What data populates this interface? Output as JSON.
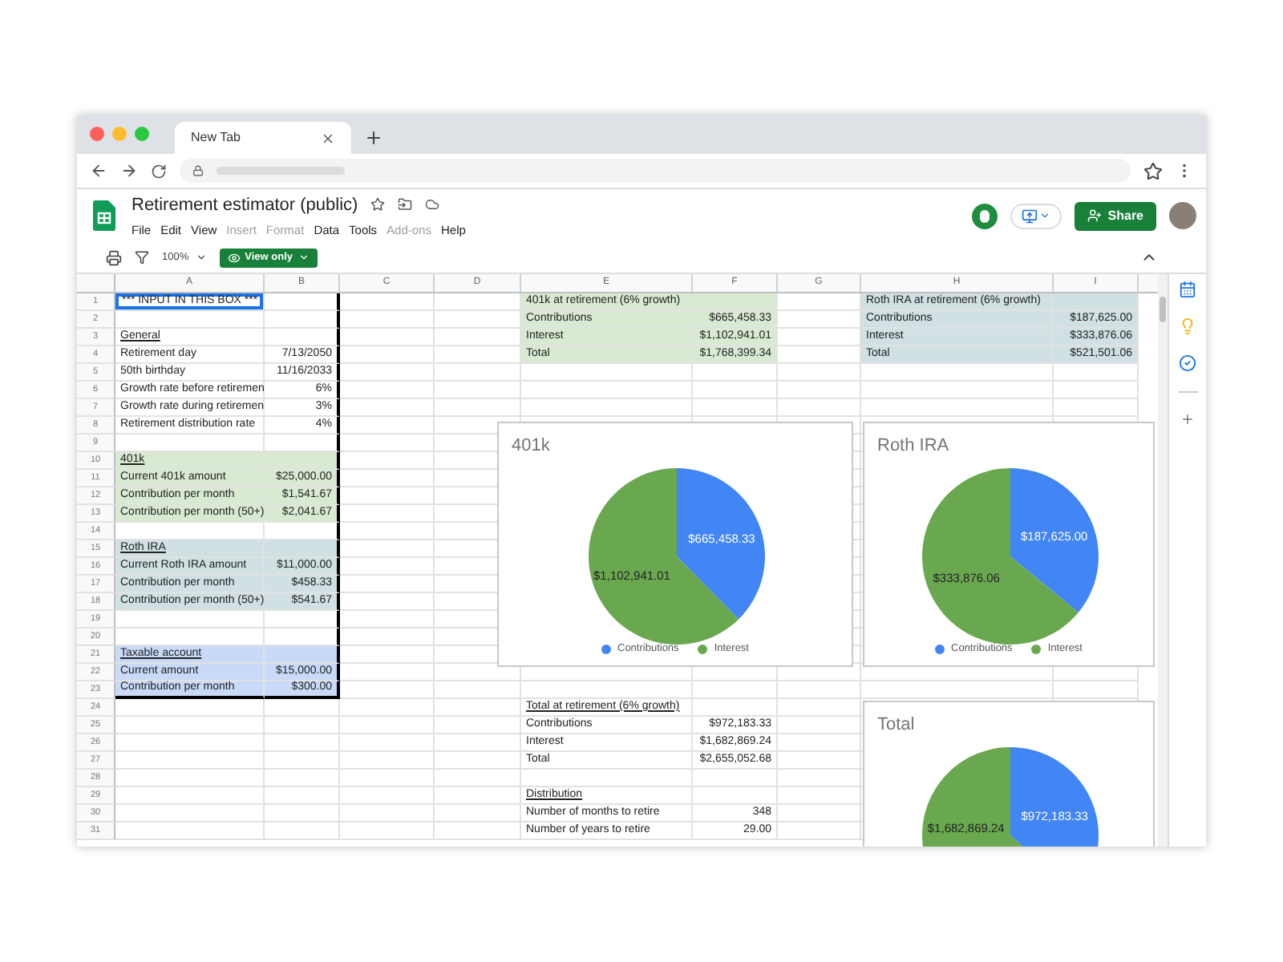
{
  "browser": {
    "tab": {
      "title": "New Tab"
    }
  },
  "document": {
    "title": "Retirement estimator (public)",
    "share_button": "Share",
    "menu": [
      {
        "label": "File",
        "disabled": false
      },
      {
        "label": "Edit",
        "disabled": false
      },
      {
        "label": "View",
        "disabled": false
      },
      {
        "label": "Insert",
        "disabled": true
      },
      {
        "label": "Format",
        "disabled": true
      },
      {
        "label": "Data",
        "disabled": false
      },
      {
        "label": "Tools",
        "disabled": false
      },
      {
        "label": "Add-ons",
        "disabled": true
      },
      {
        "label": "Help",
        "disabled": false
      }
    ]
  },
  "toolbar": {
    "zoom": "100%",
    "mode_button": "View only"
  },
  "sheet": {
    "columns": [
      "A",
      "B",
      "C",
      "D",
      "E",
      "F",
      "G",
      "H",
      "I"
    ],
    "rows": [
      {
        "number": "1",
        "boxed": true,
        "cells": {
          "A": {
            "kind": "active",
            "text": "*** INPUT IN THIS BOX ***"
          },
          "E": {
            "kind": "label",
            "text": "401k at retirement (6% growth)",
            "color": "#d9ead3"
          },
          "F": {
            "color": "#d9ead3"
          },
          "H": {
            "kind": "label",
            "text": "Roth IRA at retirement (6% growth)",
            "color": "#d0e0e3"
          },
          "I": {
            "color": "#d0e0e3"
          }
        }
      },
      {
        "number": "2",
        "boxed": true,
        "cells": {
          "E": {
            "kind": "label",
            "text": "Contributions",
            "color": "#d9ead3"
          },
          "F": {
            "kind": "number",
            "text": "$665,458.33",
            "color": "#d9ead3"
          },
          "H": {
            "kind": "label",
            "text": "Contributions",
            "color": "#d0e0e3"
          },
          "I": {
            "kind": "number",
            "text": "$187,625.00",
            "color": "#d0e0e3"
          }
        }
      },
      {
        "number": "3",
        "boxed": true,
        "cells": {
          "A": {
            "kind": "heading",
            "text": "General"
          },
          "E": {
            "kind": "label",
            "text": "Interest",
            "color": "#d9ead3"
          },
          "F": {
            "kind": "number",
            "text": "$1,102,941.01",
            "color": "#d9ead3"
          },
          "H": {
            "kind": "label",
            "text": "Interest",
            "color": "#d0e0e3"
          },
          "I": {
            "kind": "number",
            "text": "$333,876.06",
            "color": "#d0e0e3"
          }
        }
      },
      {
        "number": "4",
        "boxed": true,
        "cells": {
          "A": {
            "kind": "label",
            "text": "Retirement day"
          },
          "B": {
            "kind": "number",
            "text": "7/13/2050"
          },
          "E": {
            "kind": "label",
            "text": "Total",
            "color": "#d9ead3"
          },
          "F": {
            "kind": "number",
            "text": "$1,768,399.34",
            "color": "#d9ead3"
          },
          "H": {
            "kind": "label",
            "text": "Total",
            "color": "#d0e0e3"
          },
          "I": {
            "kind": "number",
            "text": "$521,501.06",
            "color": "#d0e0e3"
          }
        }
      },
      {
        "number": "5",
        "boxed": true,
        "cells": {
          "A": {
            "kind": "label",
            "text": "50th birthday"
          },
          "B": {
            "kind": "number",
            "text": "11/16/2033"
          }
        }
      },
      {
        "number": "6",
        "boxed": true,
        "cells": {
          "A": {
            "kind": "label",
            "text": "Growth rate before retiremen"
          },
          "B": {
            "kind": "number",
            "text": "6%"
          }
        }
      },
      {
        "number": "7",
        "boxed": true,
        "cells": {
          "A": {
            "kind": "label",
            "text": "Growth rate during retiremen"
          },
          "B": {
            "kind": "number",
            "text": "3%"
          }
        }
      },
      {
        "number": "8",
        "boxed": true,
        "cells": {
          "A": {
            "kind": "label",
            "text": "Retirement distribution rate"
          },
          "B": {
            "kind": "number",
            "text": "4%"
          }
        }
      },
      {
        "number": "9",
        "boxed": true,
        "cells": {}
      },
      {
        "number": "10",
        "boxed": true,
        "cells": {
          "A": {
            "kind": "heading",
            "text": "401k",
            "color": "#d9ead3"
          },
          "B": {
            "color": "#d9ead3"
          }
        }
      },
      {
        "number": "11",
        "boxed": true,
        "cells": {
          "A": {
            "kind": "label",
            "text": "Current 401k amount",
            "color": "#d9ead3"
          },
          "B": {
            "kind": "number",
            "text": "$25,000.00",
            "color": "#d9ead3"
          }
        }
      },
      {
        "number": "12",
        "boxed": true,
        "cells": {
          "A": {
            "kind": "label",
            "text": "Contribution per month",
            "color": "#d9ead3"
          },
          "B": {
            "kind": "number",
            "text": "$1,541.67",
            "color": "#d9ead3"
          }
        }
      },
      {
        "number": "13",
        "boxed": true,
        "cells": {
          "A": {
            "kind": "label",
            "text": "Contribution per month (50+)",
            "color": "#d9ead3"
          },
          "B": {
            "kind": "number",
            "text": "$2,041.67",
            "color": "#d9ead3"
          }
        }
      },
      {
        "number": "14",
        "boxed": true,
        "cells": {}
      },
      {
        "number": "15",
        "boxed": true,
        "cells": {
          "A": {
            "kind": "heading",
            "text": "Roth IRA",
            "color": "#d0e0e3"
          },
          "B": {
            "color": "#d0e0e3"
          }
        }
      },
      {
        "number": "16",
        "boxed": true,
        "cells": {
          "A": {
            "kind": "label",
            "text": "Current Roth IRA amount",
            "color": "#d0e0e3"
          },
          "B": {
            "kind": "number",
            "text": "$11,000.00",
            "color": "#d0e0e3"
          }
        }
      },
      {
        "number": "17",
        "boxed": true,
        "cells": {
          "A": {
            "kind": "label",
            "text": "Contribution per month",
            "color": "#d0e0e3"
          },
          "B": {
            "kind": "number",
            "text": "$458.33",
            "color": "#d0e0e3"
          }
        }
      },
      {
        "number": "18",
        "boxed": true,
        "cells": {
          "A": {
            "kind": "label",
            "text": "Contribution per month (50+)",
            "color": "#d0e0e3"
          },
          "B": {
            "kind": "number",
            "text": "$541.67",
            "color": "#d0e0e3"
          }
        }
      },
      {
        "number": "19",
        "boxed": true,
        "cells": {}
      },
      {
        "number": "20",
        "boxed": true,
        "cells": {}
      },
      {
        "number": "21",
        "boxed": true,
        "cells": {
          "A": {
            "kind": "heading",
            "text": "Taxable account",
            "color": "#c9daf8"
          },
          "B": {
            "color": "#c9daf8"
          }
        }
      },
      {
        "number": "22",
        "boxed": true,
        "cells": {
          "A": {
            "kind": "label",
            "text": "Current amount",
            "color": "#c9daf8"
          },
          "B": {
            "kind": "number",
            "text": "$15,000.00",
            "color": "#c9daf8"
          }
        }
      },
      {
        "number": "23",
        "boxed": true,
        "cells": {
          "A": {
            "kind": "label",
            "text": "Contribution per month",
            "color": "#c9daf8"
          },
          "B": {
            "kind": "number",
            "text": "$300.00",
            "color": "#c9daf8"
          }
        }
      },
      {
        "number": "24",
        "boxed": false,
        "cells": {
          "E": {
            "kind": "heading",
            "text": "Total at retirement (6% growth)"
          }
        }
      },
      {
        "number": "25",
        "boxed": false,
        "cells": {
          "E": {
            "kind": "label",
            "text": "Contributions"
          },
          "F": {
            "kind": "number",
            "text": "$972,183.33"
          }
        }
      },
      {
        "number": "26",
        "boxed": false,
        "cells": {
          "E": {
            "kind": "label",
            "text": "Interest"
          },
          "F": {
            "kind": "number",
            "text": "$1,682,869.24"
          }
        }
      },
      {
        "number": "27",
        "boxed": false,
        "cells": {
          "E": {
            "kind": "label",
            "text": "Total"
          },
          "F": {
            "kind": "number",
            "text": "$2,655,052.68"
          }
        }
      },
      {
        "number": "28",
        "boxed": false,
        "cells": {}
      },
      {
        "number": "29",
        "boxed": false,
        "cells": {
          "E": {
            "kind": "heading",
            "text": "Distribution"
          }
        }
      },
      {
        "number": "30",
        "boxed": false,
        "cells": {
          "E": {
            "kind": "label",
            "text": "Number of months to retire"
          },
          "F": {
            "kind": "number",
            "text": "348"
          }
        }
      },
      {
        "number": "31",
        "boxed": false,
        "cells": {
          "E": {
            "kind": "label",
            "text": "Number of years to retire"
          },
          "F": {
            "kind": "number",
            "text": "29.00"
          }
        }
      }
    ]
  },
  "charts": [
    {
      "chart_data": {
        "type": "pie",
        "title": "401k",
        "categories": [
          "Contributions",
          "Interest"
        ],
        "legend": "bottom",
        "values": [
          665458.33,
          1102941.01
        ],
        "data_labels": true,
        "value_labels": [
          "$665,458.33",
          "$1,102,941.01"
        ]
      }
    },
    {
      "chart_data": {
        "type": "pie",
        "title": "Roth IRA",
        "categories": [
          "Contributions",
          "Interest"
        ],
        "legend": "bottom",
        "values": [
          187625.0,
          333876.06
        ],
        "data_labels": true,
        "value_labels": [
          "$187,625.00",
          "$333,876.06"
        ]
      }
    },
    {
      "chart_data": {
        "type": "pie",
        "title": "Total",
        "values": [
          972183.33,
          1682869.24
        ],
        "data_labels": true,
        "value_labels": [
          "$972,183.33",
          "$1,682,869.24"
        ]
      }
    }
  ]
}
